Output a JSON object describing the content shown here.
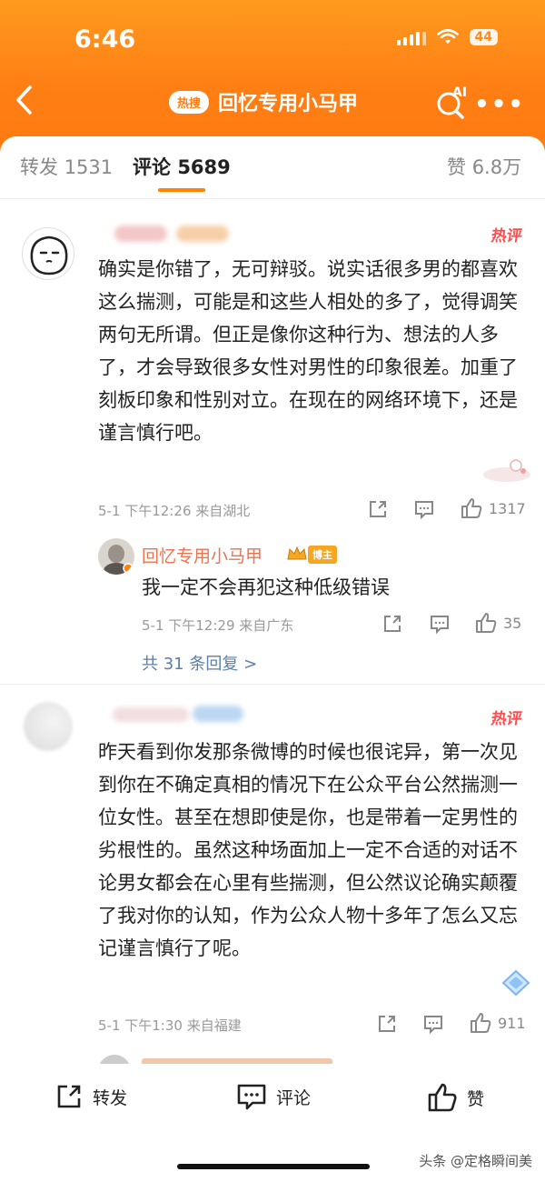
{
  "status_bar": {
    "time": "6:46",
    "battery": "44"
  },
  "nav": {
    "hot_pill": "热搜",
    "title": "回忆专用小马甲",
    "ai_label": "AI"
  },
  "tabs": [
    {
      "label": "转发",
      "count": "1531"
    },
    {
      "label": "评论",
      "count": "5689"
    },
    {
      "label": "赞",
      "count": "6.8万"
    }
  ],
  "comments": [
    {
      "hot_label": "热评",
      "text": "确实是你错了，无可辩驳。说实话很多男的都喜欢这么揣测，可能是和这些人相处的多了，觉得调笑两句无所谓。但正是像你这种行为、想法的人多了，才会导致很多女性对男性的印象很差。加重了刻板印象和性别对立。在现在的网络环境下，还是谨言慎行吧。",
      "date": "5-1 下午12:26",
      "source": "来自湖北",
      "likes": "1317",
      "reply": {
        "author": "回忆专用小马甲",
        "badge": "博主",
        "text": "我一定不会再犯这种低级错误",
        "date": "5-1 下午12:29",
        "source": "来自广东",
        "likes": "35"
      },
      "more_replies": "共 31 条回复 >"
    },
    {
      "hot_label": "热评",
      "text": "昨天看到你发那条微博的时候也很诧异，第一次见到你在不确定真相的情况下在公众平台公然揣测一位女性。甚至在想即使是你，也是带着一定男性的劣根性的。虽然这种场面加上一定不合适的对话不论男女都会在心里有些揣测，但公然议论确实颠覆了我对你的认知，作为公众人物十多年了怎么又忘记谨言慎行了呢。",
      "date": "5-1 下午1:30",
      "source": "来自福建",
      "likes": "911"
    }
  ],
  "bottom_bar": {
    "repost": "转发",
    "comment": "评论",
    "like": "赞"
  },
  "watermark": "头条 @定格瞬间美",
  "colors": {
    "header_orange": "#ff8a1a",
    "hot_red": "#ff4d4f",
    "reply_name": "#eb7350",
    "link_blue": "#5b7fa8",
    "tab_underline": "#ff8200"
  }
}
